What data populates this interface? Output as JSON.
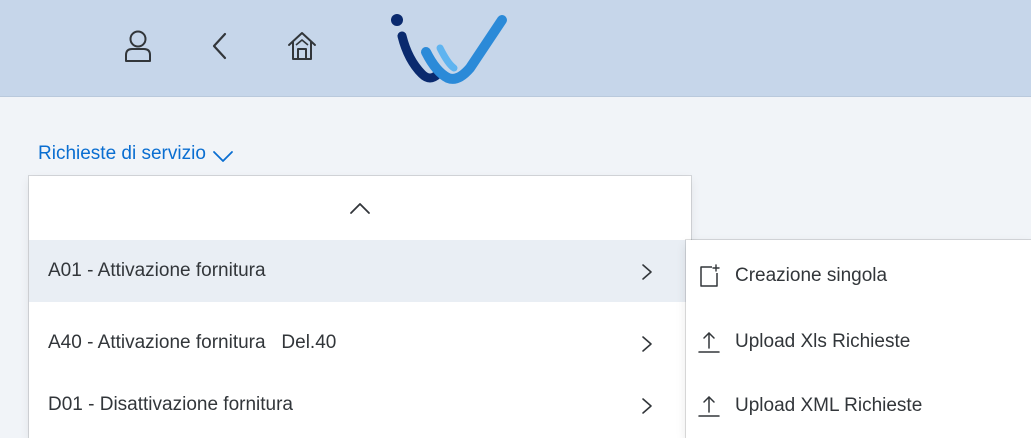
{
  "shell": {
    "icons": [
      "user-icon",
      "back-icon",
      "home-icon"
    ],
    "logo_colors": [
      "#0a2a6e",
      "#2b8ad8",
      "#5fb4f0"
    ]
  },
  "page": {
    "title": "Richieste di servizio"
  },
  "menu": {
    "items": [
      {
        "label": "A01 - Attivazione fornitura"
      },
      {
        "label": "A40 - Attivazione fornitura   Del.40"
      },
      {
        "label": "D01 - Disattivazione fornitura"
      }
    ]
  },
  "submenu": {
    "items": [
      {
        "label": "Creazione singola",
        "icon": "new-document-icon"
      },
      {
        "label": "Upload Xls Richieste",
        "icon": "upload-icon"
      },
      {
        "label": "Upload XML Richieste",
        "icon": "upload-icon"
      }
    ]
  },
  "colors": {
    "shell_bg": "#c6d6ea",
    "link": "#0a6ed1",
    "active_row": "#e9eef4"
  }
}
